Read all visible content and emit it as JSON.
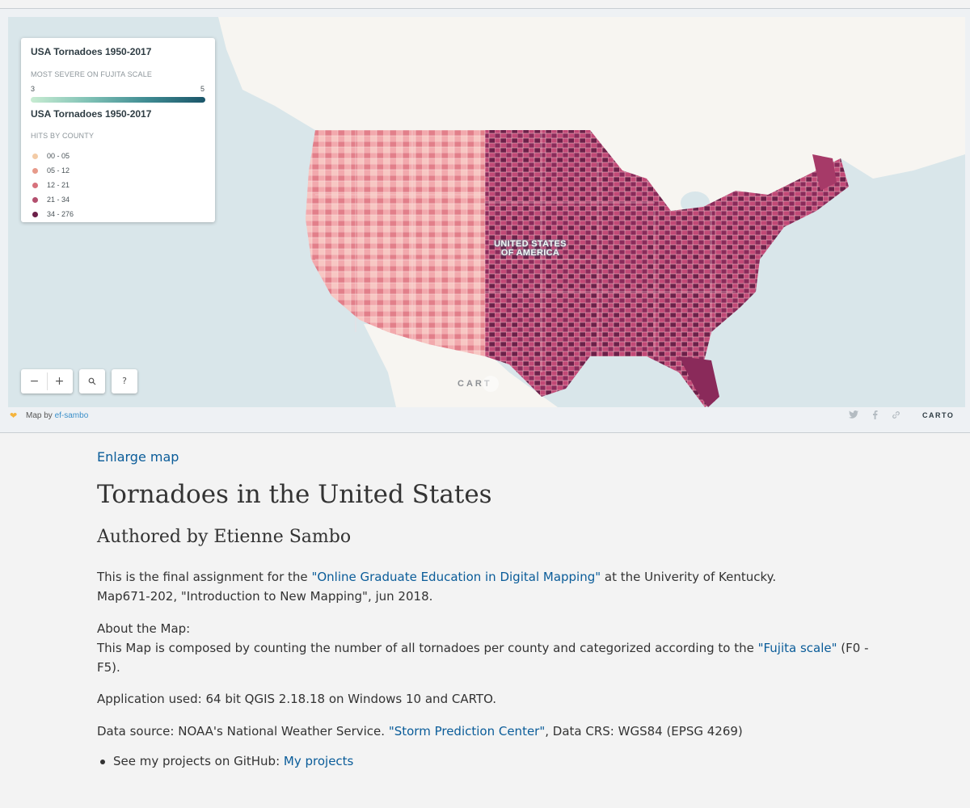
{
  "map": {
    "legend": {
      "title1": "USA Tornadoes 1950-2017",
      "subtitle1": "MOST SEVERE ON FUJITA SCALE",
      "scale_min": "3",
      "scale_max": "5",
      "title2": "USA Tornadoes 1950-2017",
      "subtitle2": "HITS BY COUNTY",
      "items": [
        {
          "label": "00 - 05",
          "color": "#f3cba6"
        },
        {
          "label": "05 - 12",
          "color": "#e79a8a"
        },
        {
          "label": "12 - 21",
          "color": "#d7727c"
        },
        {
          "label": "21 - 34",
          "color": "#b34f6e"
        },
        {
          "label": "34 - 276",
          "color": "#6c2049"
        }
      ]
    },
    "country_label_line1": "UNITED STATES",
    "country_label_line2": "OF AMERICA",
    "controls": {
      "zoom_out": "−",
      "zoom_in": "+",
      "search_icon": "search-icon",
      "help": "?"
    },
    "watermark": "CART",
    "footer": {
      "mapby_prefix": "Map by",
      "author_link": "ef-sambo",
      "share_icons": [
        "twitter-icon",
        "facebook-icon",
        "link-icon"
      ],
      "logo": "CARTO"
    },
    "colors": {
      "water": "#d9e6ea",
      "land": "#f7f5f1"
    }
  },
  "page": {
    "enlarge_link": "Enlarge map",
    "title": "Tornadoes in the United States",
    "author": "Authored by Etienne Sambo",
    "p1_pre": "This is the final assignment for the ",
    "p1_link": "\"Online Graduate Education in Digital Mapping\"",
    "p1_post": " at the Univerity of Kentucky.",
    "p1_line2": "Map671-202, \"Introduction to New Mapping\", jun 2018.",
    "p2_heading": "About the Map:",
    "p2_pre": "This Map is composed by counting the number of all tornadoes per county and categorized according to the ",
    "p2_link": "\"Fujita scale\"",
    "p2_post": " (F0 - F5).",
    "p3": "Application used: 64 bit QGIS 2.18.18 on Windows 10 and CARTO.",
    "p4_pre": "Data source: NOAA's National Weather Service. ",
    "p4_link": "\"Storm Prediction Center\"",
    "p4_post": ", Data CRS: WGS84 (EPSG 4269)",
    "bullet_pre": "See my projects on GitHub: ",
    "bullet_link": "My projects"
  }
}
